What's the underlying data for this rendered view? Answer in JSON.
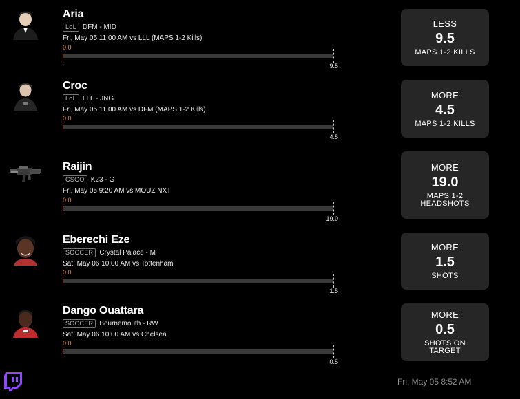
{
  "players": [
    {
      "name": "Aria",
      "league": "LoL",
      "team_position": "DFM - MID",
      "game": "Fri, May 05 11:00 AM  vs LLL (MAPS 1-2 Kills)",
      "current": "0.0",
      "line": "9.5",
      "progress": 0,
      "pick": {
        "direction": "LESS",
        "value": "9.5",
        "stat": "MAPS 1-2 KILLS"
      },
      "avatar": "player-photo"
    },
    {
      "name": "Croc",
      "league": "LoL",
      "team_position": "LLL - JNG",
      "game": "Fri, May 05 11:00 AM  vs DFM (MAPS 1-2 Kills)",
      "current": "0.0",
      "line": "4.5",
      "progress": 0,
      "pick": {
        "direction": "MORE",
        "value": "4.5",
        "stat": "MAPS 1-2 KILLS"
      },
      "avatar": "player-photo"
    },
    {
      "name": "Raijin",
      "league": "CSGO",
      "team_position": "K23 - G",
      "game": "Fri, May 05 9:20 AM  vs MOUZ NXT",
      "current": "0.0",
      "line": "19.0",
      "progress": 0,
      "pick": {
        "direction": "MORE",
        "value": "19.0",
        "stat": "MAPS 1-2 HEADSHOTS"
      },
      "avatar": "rifle-icon"
    },
    {
      "name": "Eberechi Eze",
      "league": "SOCCER",
      "team_position": "Crystal Palace - M",
      "game": "Sat, May 06 10:00 AM  vs Tottenham",
      "current": "0.0",
      "line": "1.5",
      "progress": 0,
      "pick": {
        "direction": "MORE",
        "value": "1.5",
        "stat": "SHOTS"
      },
      "avatar": "player-photo"
    },
    {
      "name": "Dango Ouattara",
      "league": "SOCCER",
      "team_position": "Bournemouth - RW",
      "game": "Sat, May 06 10:00 AM  vs Chelsea",
      "current": "0.0",
      "line": "0.5",
      "progress": 0,
      "pick": {
        "direction": "MORE",
        "value": "0.5",
        "stat": "SHOTS ON TARGET"
      },
      "avatar": "player-photo"
    }
  ],
  "footer": {
    "timestamp": "Fri, May 05 8:52 AM",
    "brand_icon": "twitch-icon"
  },
  "colors": {
    "background": "#000000",
    "card": "#262626",
    "progress_marker": "#e3935a",
    "track": "#3a3a3a",
    "twitch": "#9146ff"
  }
}
